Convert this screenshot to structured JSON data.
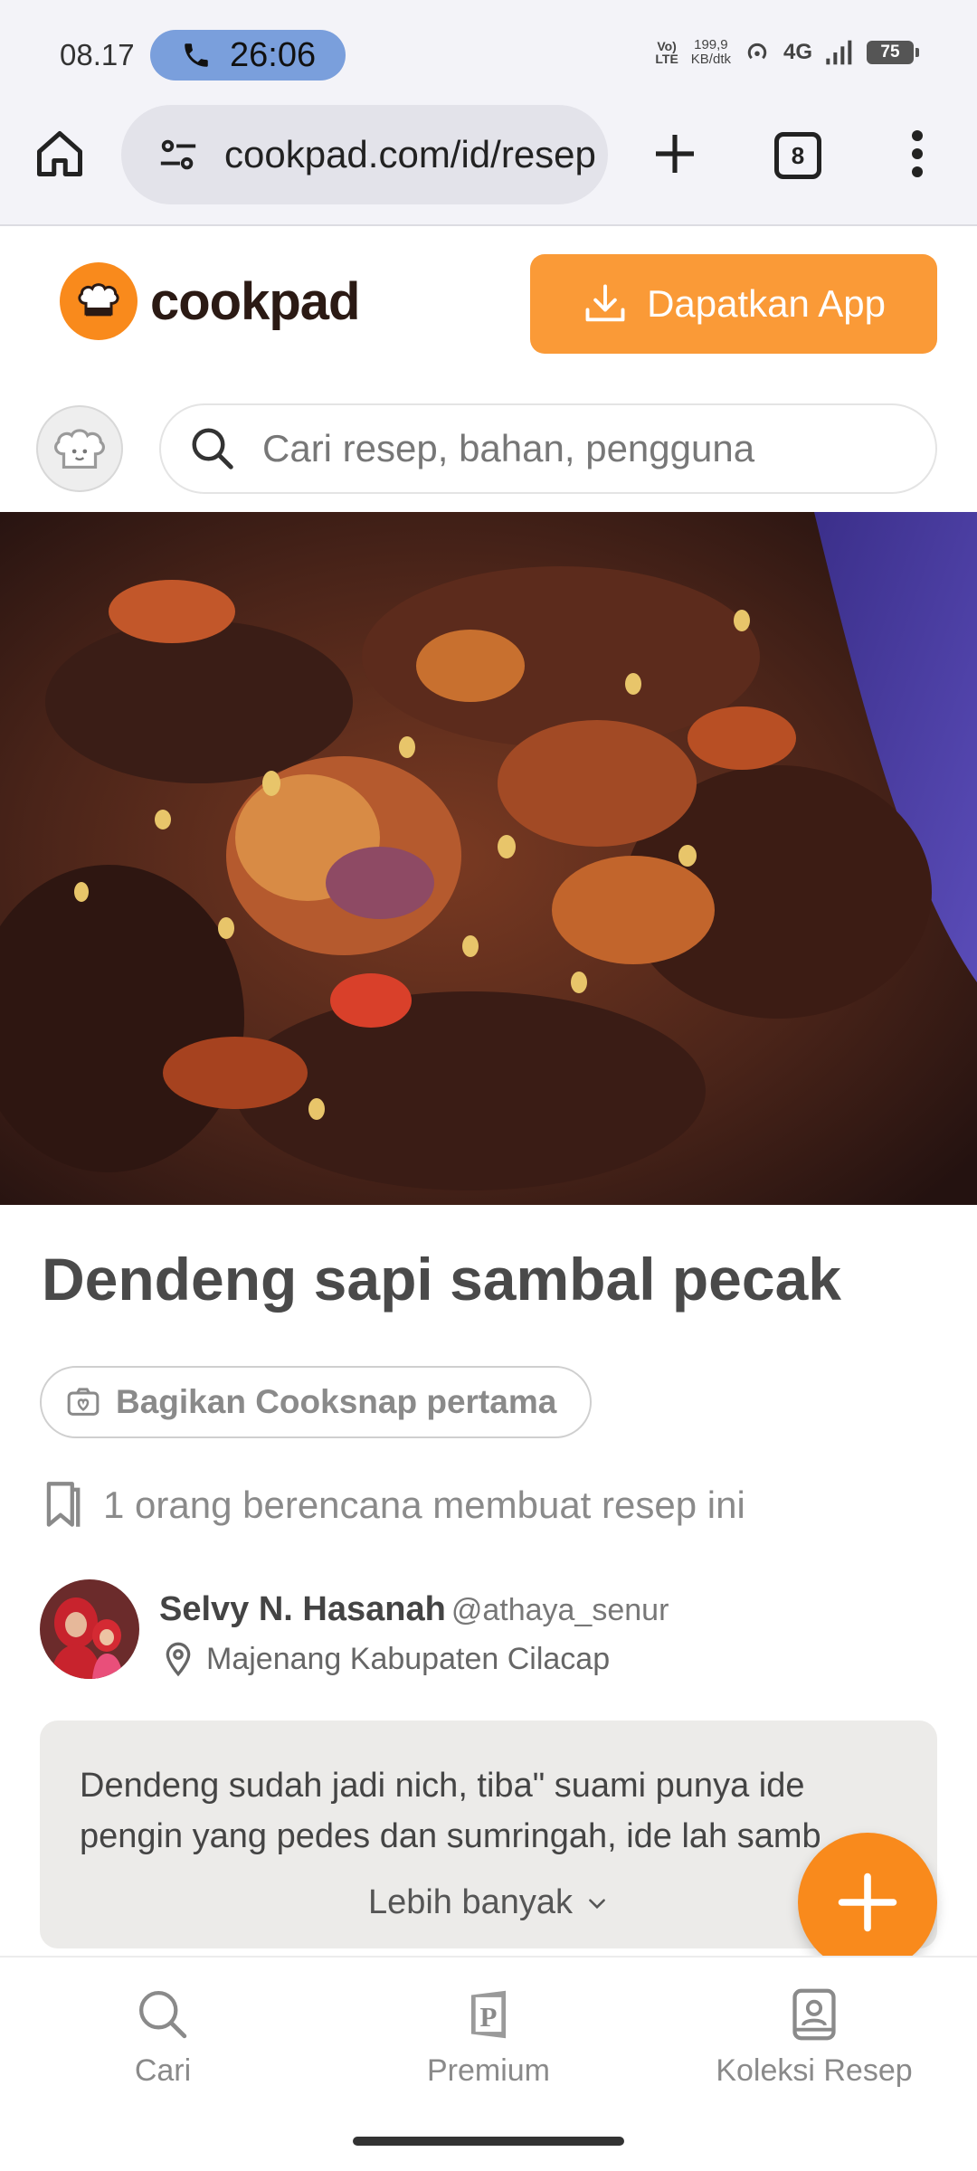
{
  "status_bar": {
    "time": "08.17",
    "call_timer": "26:06",
    "volte": "Vo)\nLTE",
    "speed_value": "199,9",
    "speed_unit": "KB/dtk",
    "network": "4G",
    "battery": "75"
  },
  "browser": {
    "url": "cookpad.com/id/resep",
    "tab_count": "8"
  },
  "header": {
    "logo_text": "cookpad",
    "get_app_label": "Dapatkan App"
  },
  "search": {
    "placeholder": "Cari resep, bahan, pengguna"
  },
  "recipe": {
    "title": "Dendeng sapi sambal pecak",
    "cooksnap_label": "Bagikan Cooksnap pertama",
    "plan_text": "1 orang berencana membuat resep ini",
    "author": {
      "name": "Selvy N. Hasanah",
      "handle": "@athaya_senur",
      "location": "Majenang Kabupaten Cilacap"
    },
    "description": "Dendeng sudah jadi nich, tiba\" suami punya ide pengin yang pedes dan sumringah, ide lah samb",
    "more_label": "Lebih banyak"
  },
  "bottom_nav": {
    "items": [
      {
        "label": "Cari",
        "icon": "search-icon"
      },
      {
        "label": "Premium",
        "icon": "premium-icon"
      },
      {
        "label": "Koleksi Resep",
        "icon": "collection-icon"
      }
    ]
  },
  "colors": {
    "brand_orange": "#f98a1c",
    "button_orange": "#fa9a37",
    "status_bg": "#f3f3f8",
    "call_pill": "#7a9fdc"
  }
}
